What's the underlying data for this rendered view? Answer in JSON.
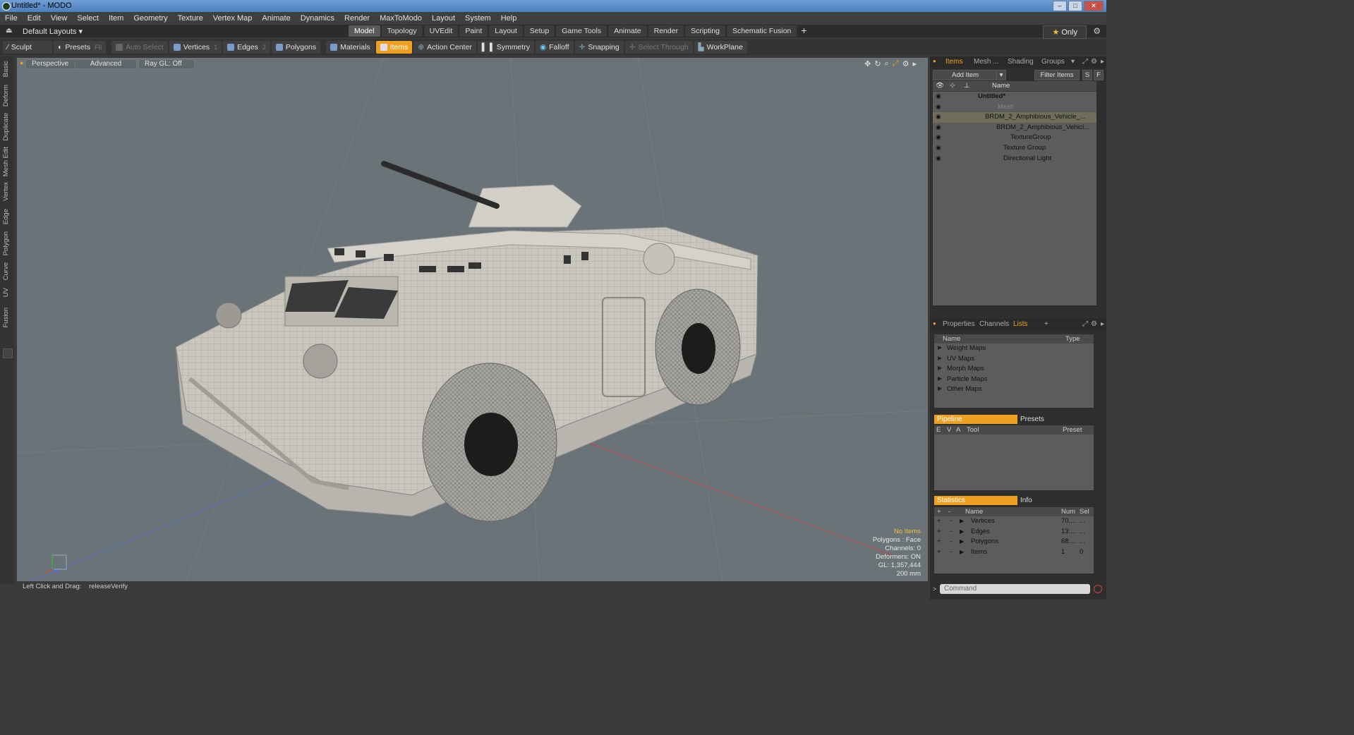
{
  "window": {
    "title": "Untitled* - MODO"
  },
  "menu": [
    "File",
    "Edit",
    "View",
    "Select",
    "Item",
    "Geometry",
    "Texture",
    "Vertex Map",
    "Animate",
    "Dynamics",
    "Render",
    "MaxToModo",
    "Layout",
    "System",
    "Help"
  ],
  "layout": {
    "name": "Default Layouts ▾",
    "tabs": [
      "Model",
      "Topology",
      "UVEdit",
      "Paint",
      "Layout",
      "Setup",
      "Game Tools",
      "Animate",
      "Render",
      "Scripting",
      "Schematic Fusion"
    ],
    "active_tab": "Model",
    "plus": "+",
    "only_label": "Only"
  },
  "toolbar": {
    "sculpt": "Sculpt",
    "presets": "Presets",
    "presets_key": "F6",
    "auto_select": "Auto Select",
    "vertices": "Vertices",
    "vertices_key": "1",
    "edges": "Edges",
    "edges_key": "2",
    "polygons": "Polygons",
    "materials": "Materials",
    "items": "Items",
    "action_center": "Action Center",
    "symmetry": "Symmetry",
    "falloff": "Falloff",
    "snapping": "Snapping",
    "select_through": "Select Through",
    "workplane": "WorkPlane"
  },
  "left_tabs": [
    "Basic",
    "Deform",
    "Duplicate",
    "Mesh Edit",
    "Vertex",
    "Edge",
    "Polygon",
    "Curve",
    "UV",
    "Fusion"
  ],
  "viewport": {
    "view": "Perspective",
    "shading": "Advanced",
    "raygl": "Ray GL: Off",
    "info": {
      "no_items": "No Items",
      "polygons": "Polygons : Face",
      "channels": "Channels: 0",
      "deformers": "Deformers: ON",
      "gl": "GL: 1,357,444",
      "scale": "200 mm"
    }
  },
  "status": {
    "action": "Left Click and Drag:",
    "value": "releaseVerify"
  },
  "items_panel": {
    "tabs": [
      "Items",
      "Mesh ...",
      "Shading",
      "Groups"
    ],
    "add_item": "Add Item",
    "filter": "Filter Items",
    "s": "S",
    "f": "F",
    "name_header": "Name",
    "rows": [
      {
        "label": "Untitled*"
      },
      {
        "label": "Mesh"
      },
      {
        "label": "BRDM_2_Amphibious_Vehicle_..."
      },
      {
        "label": "BRDM_2_Amphibious_Vehicl..."
      },
      {
        "label": "TextureGroup"
      },
      {
        "label": "Texture Group"
      },
      {
        "label": "Directional Light"
      }
    ]
  },
  "props_panel": {
    "tabs": [
      "Properties",
      "Channels",
      "Lists"
    ],
    "plus": "+",
    "name_header": "Name",
    "type_header": "Type",
    "rows": [
      "Weight Maps",
      "UV Maps",
      "Morph Maps",
      "Particle Maps",
      "Other Maps"
    ]
  },
  "pipeline": {
    "tab_pipeline": "Pipeline",
    "tab_presets": "Presets",
    "col_e": "E",
    "col_v": "V",
    "col_a": "A",
    "col_tool": "Tool",
    "col_preset": "Preset"
  },
  "stats": {
    "tab_stats": "Statistics",
    "tab_info": "Info",
    "col_plus": "+",
    "col_minus": "-",
    "col_name": "Name",
    "col_num": "Num",
    "col_sel": "Sel",
    "rows": [
      {
        "name": "Vertices",
        "num": "70....",
        "sel": "..."
      },
      {
        "name": "Edges",
        "num": "13....",
        "sel": "..."
      },
      {
        "name": "Polygons",
        "num": "68....",
        "sel": "..."
      },
      {
        "name": "Items",
        "num": "1",
        "sel": "0"
      }
    ]
  },
  "command": {
    "placeholder": "Command"
  }
}
